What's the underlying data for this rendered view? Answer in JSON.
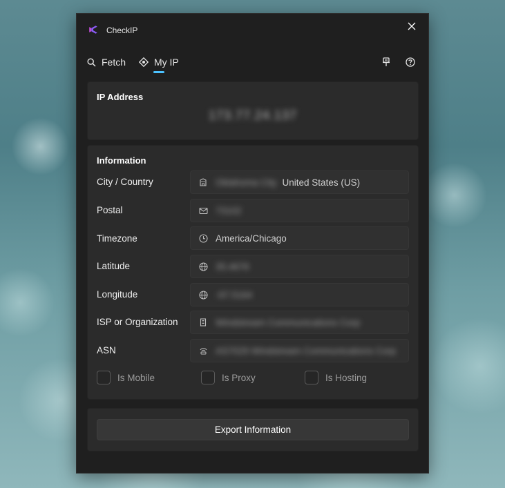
{
  "app": {
    "title": "CheckIP",
    "accent": "#4cc2ff",
    "logo_color": "#8a5cf6"
  },
  "nav": {
    "fetch_label": "Fetch",
    "myip_label": "My IP",
    "active_tab": "My IP",
    "icons": [
      "search-icon",
      "location-icon",
      "pin-icon",
      "help-icon"
    ]
  },
  "ip_card": {
    "title": "IP Address",
    "value": "173.77.24.137"
  },
  "info": {
    "title": "Information",
    "rows": [
      {
        "label": "City / Country",
        "icon": "building-icon",
        "hidden_value": "Oklahoma City",
        "value": "United States (US)"
      },
      {
        "label": "Postal",
        "icon": "mail-icon",
        "hidden_value": "73102",
        "value": ""
      },
      {
        "label": "Timezone",
        "icon": "clock-icon",
        "hidden_value": "",
        "value": "America/Chicago"
      },
      {
        "label": "Latitude",
        "icon": "globe-icon",
        "hidden_value": "35.4676",
        "value": ""
      },
      {
        "label": "Longitude",
        "icon": "globe-icon",
        "hidden_value": "-97.5164",
        "value": ""
      },
      {
        "label": "ISP or Organization",
        "icon": "office-icon",
        "hidden_value": "Windstream Communications Corp",
        "value": ""
      },
      {
        "label": "ASN",
        "icon": "network-icon",
        "hidden_value": "AS7029 Windstream Communications Corp",
        "value": ""
      }
    ],
    "checkboxes": [
      {
        "label": "Is Mobile",
        "checked": false
      },
      {
        "label": "Is Proxy",
        "checked": false
      },
      {
        "label": "Is Hosting",
        "checked": false
      }
    ]
  },
  "actions": {
    "export_label": "Export Information"
  }
}
